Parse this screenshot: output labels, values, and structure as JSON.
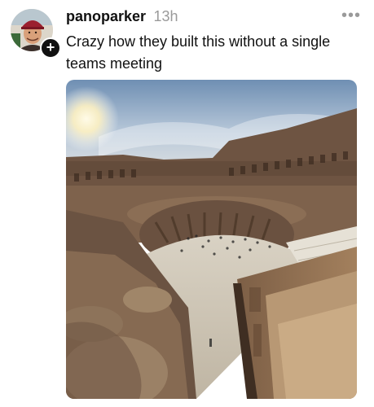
{
  "post": {
    "username": "panoparker",
    "timestamp": "13h",
    "text": "Crazy how they built this without a single teams meeting",
    "more_icon": "more-horizontal-icon",
    "follow_icon": "plus-icon",
    "follow_glyph": "+",
    "media_subject": "photo of the Colosseum interior"
  }
}
